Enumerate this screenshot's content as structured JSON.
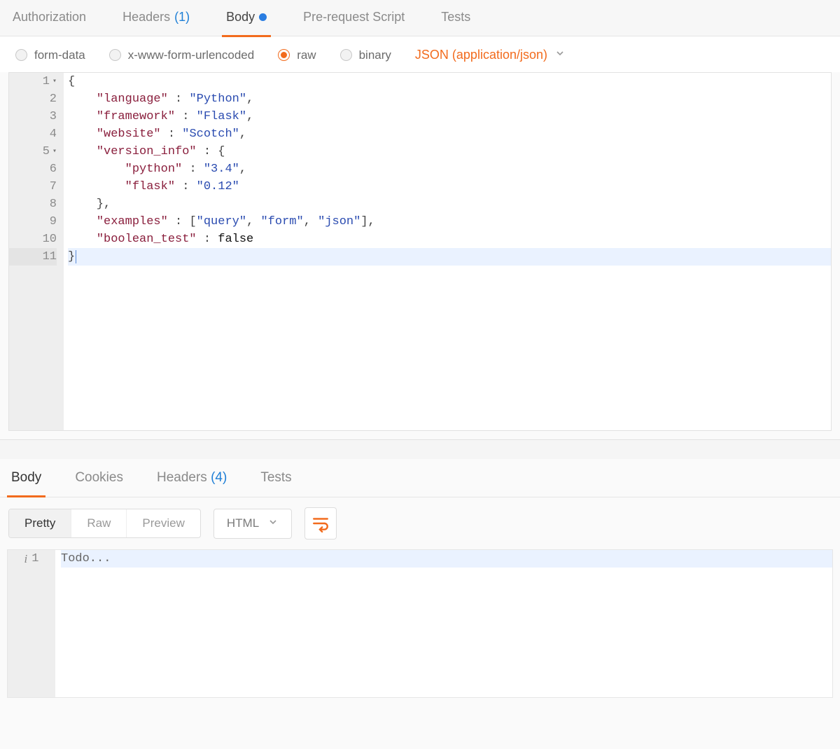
{
  "requestTabs": [
    {
      "label": "Authorization",
      "active": false,
      "badge": null,
      "dot": false
    },
    {
      "label": "Headers",
      "active": false,
      "badge": "(1)",
      "dot": false
    },
    {
      "label": "Body",
      "active": true,
      "badge": null,
      "dot": true
    },
    {
      "label": "Pre-request Script",
      "active": false,
      "badge": null,
      "dot": false
    },
    {
      "label": "Tests",
      "active": false,
      "badge": null,
      "dot": false
    }
  ],
  "bodyTypes": [
    {
      "label": "form-data",
      "selected": false
    },
    {
      "label": "x-www-form-urlencoded",
      "selected": false
    },
    {
      "label": "raw",
      "selected": true
    },
    {
      "label": "binary",
      "selected": false
    }
  ],
  "contentTypeLabel": "JSON (application/json)",
  "editor": {
    "lines": [
      {
        "n": "1",
        "fold": true,
        "hl": false,
        "tokens": [
          [
            "p",
            "{"
          ]
        ]
      },
      {
        "n": "2",
        "fold": false,
        "hl": false,
        "tokens": [
          [
            "p",
            "    "
          ],
          [
            "k",
            "\"language\""
          ],
          [
            "p",
            " : "
          ],
          [
            "s",
            "\"Python\""
          ],
          [
            "p",
            ","
          ]
        ]
      },
      {
        "n": "3",
        "fold": false,
        "hl": false,
        "tokens": [
          [
            "p",
            "    "
          ],
          [
            "k",
            "\"framework\""
          ],
          [
            "p",
            " : "
          ],
          [
            "s",
            "\"Flask\""
          ],
          [
            "p",
            ","
          ]
        ]
      },
      {
        "n": "4",
        "fold": false,
        "hl": false,
        "tokens": [
          [
            "p",
            "    "
          ],
          [
            "k",
            "\"website\""
          ],
          [
            "p",
            " : "
          ],
          [
            "s",
            "\"Scotch\""
          ],
          [
            "p",
            ","
          ]
        ]
      },
      {
        "n": "5",
        "fold": true,
        "hl": false,
        "tokens": [
          [
            "p",
            "    "
          ],
          [
            "k",
            "\"version_info\""
          ],
          [
            "p",
            " : {"
          ]
        ]
      },
      {
        "n": "6",
        "fold": false,
        "hl": false,
        "tokens": [
          [
            "p",
            "        "
          ],
          [
            "k",
            "\"python\""
          ],
          [
            "p",
            " : "
          ],
          [
            "s",
            "\"3.4\""
          ],
          [
            "p",
            ","
          ]
        ]
      },
      {
        "n": "7",
        "fold": false,
        "hl": false,
        "tokens": [
          [
            "p",
            "        "
          ],
          [
            "k",
            "\"flask\""
          ],
          [
            "p",
            " : "
          ],
          [
            "s",
            "\"0.12\""
          ]
        ]
      },
      {
        "n": "8",
        "fold": false,
        "hl": false,
        "tokens": [
          [
            "p",
            "    },"
          ]
        ]
      },
      {
        "n": "9",
        "fold": false,
        "hl": false,
        "tokens": [
          [
            "p",
            "    "
          ],
          [
            "k",
            "\"examples\""
          ],
          [
            "p",
            " : ["
          ],
          [
            "s",
            "\"query\""
          ],
          [
            "p",
            ", "
          ],
          [
            "s",
            "\"form\""
          ],
          [
            "p",
            ", "
          ],
          [
            "s",
            "\"json\""
          ],
          [
            "p",
            "],"
          ]
        ]
      },
      {
        "n": "10",
        "fold": false,
        "hl": false,
        "tokens": [
          [
            "p",
            "    "
          ],
          [
            "k",
            "\"boolean_test\""
          ],
          [
            "p",
            " : "
          ],
          [
            "b",
            "false"
          ]
        ]
      },
      {
        "n": "11",
        "fold": false,
        "hl": true,
        "tokens": [
          [
            "p",
            "}"
          ]
        ]
      }
    ]
  },
  "responseTabs": [
    {
      "label": "Body",
      "active": true,
      "badge": null
    },
    {
      "label": "Cookies",
      "active": false,
      "badge": null
    },
    {
      "label": "Headers",
      "active": false,
      "badge": "(4)"
    },
    {
      "label": "Tests",
      "active": false,
      "badge": null
    }
  ],
  "viewModes": [
    {
      "label": "Pretty",
      "active": true
    },
    {
      "label": "Raw",
      "active": false
    },
    {
      "label": "Preview",
      "active": false
    }
  ],
  "formatSelect": "HTML",
  "responseBody": {
    "lines": [
      {
        "n": "1",
        "info": true,
        "hl": true,
        "text": "Todo..."
      }
    ]
  }
}
